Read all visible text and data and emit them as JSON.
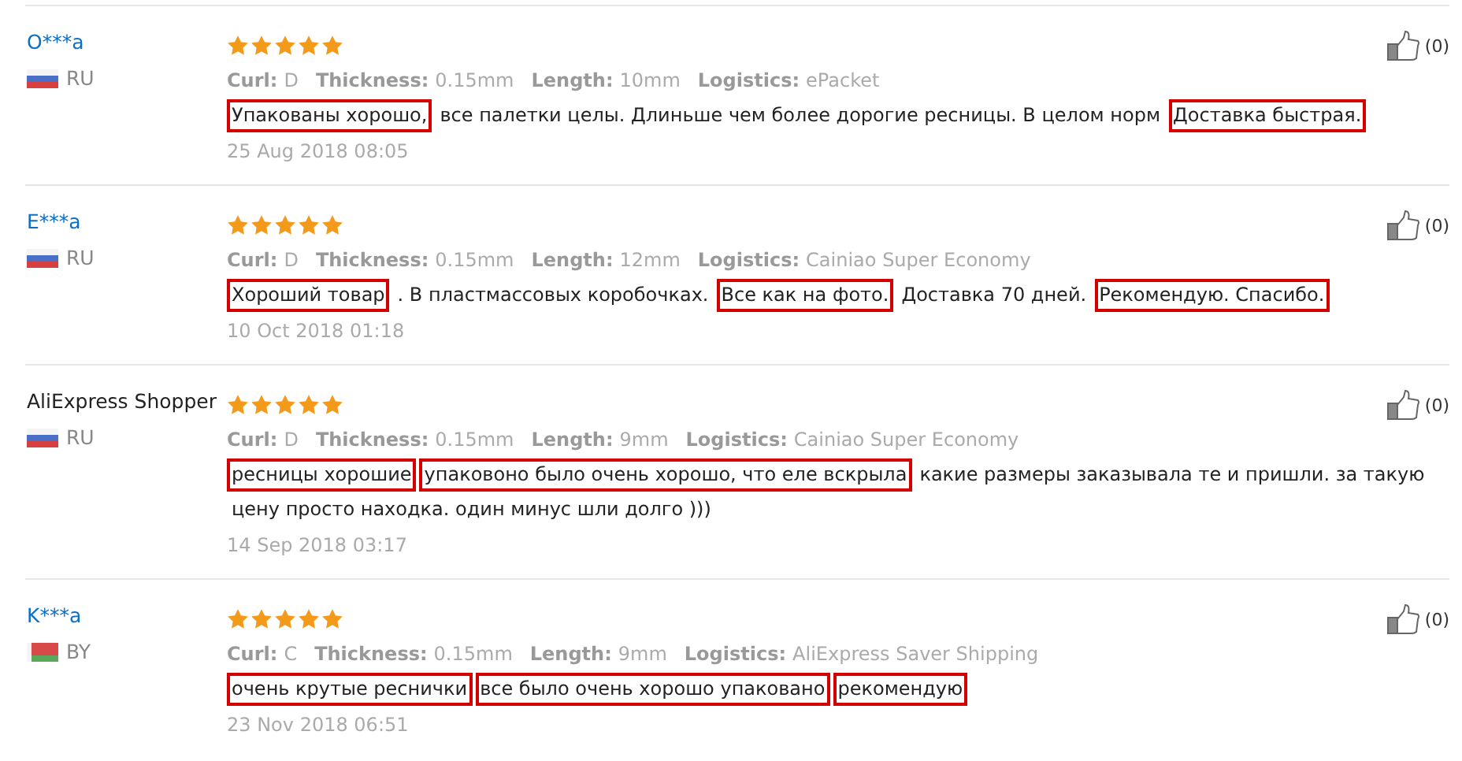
{
  "reviews": [
    {
      "name": "O***a",
      "linked": true,
      "flag": {
        "kind": "ru"
      },
      "country": "RU",
      "stars": 5,
      "likes": "(0)",
      "attributes": [
        {
          "label": "Curl:",
          "value": "D"
        },
        {
          "label": "Thickness:",
          "value": "0.15mm"
        },
        {
          "label": "Length:",
          "value": "10mm"
        },
        {
          "label": "Logistics:",
          "value": "ePacket"
        }
      ],
      "segments": [
        {
          "text": "Упакованы хорошо,",
          "highlighted": true
        },
        {
          "text": "все палетки целы. Длиньше чем более дорогие ресницы. В целом норм",
          "highlighted": false
        },
        {
          "text": "Доставка быстрая.",
          "highlighted": true
        }
      ],
      "date": "25 Aug 2018 08:05"
    },
    {
      "name": "E***a",
      "linked": true,
      "flag": {
        "kind": "ru"
      },
      "country": "RU",
      "stars": 5,
      "likes": "(0)",
      "attributes": [
        {
          "label": "Curl:",
          "value": "D"
        },
        {
          "label": "Thickness:",
          "value": "0.15mm"
        },
        {
          "label": "Length:",
          "value": "12mm"
        },
        {
          "label": "Logistics:",
          "value": "Cainiao Super Economy"
        }
      ],
      "segments": [
        {
          "text": "Хороший товар",
          "highlighted": true
        },
        {
          "text": ". В пластмассовых коробочках.",
          "highlighted": false
        },
        {
          "text": "Все как на фото.",
          "highlighted": true
        },
        {
          "text": "Доставка 70 дней.",
          "highlighted": false
        },
        {
          "text": "Рекомендую. Спасибо.",
          "highlighted": true
        }
      ],
      "date": "10 Oct 2018 01:18"
    },
    {
      "name": "AliExpress Shopper",
      "linked": false,
      "flag": {
        "kind": "ru"
      },
      "country": "RU",
      "stars": 5,
      "likes": "(0)",
      "attributes": [
        {
          "label": "Curl:",
          "value": "D"
        },
        {
          "label": "Thickness:",
          "value": "0.15mm"
        },
        {
          "label": "Length:",
          "value": "9mm"
        },
        {
          "label": "Logistics:",
          "value": "Cainiao Super Economy"
        }
      ],
      "segments": [
        {
          "text": "ресницы хорошие",
          "highlighted": true
        },
        {
          "text": "упаковоно было очень хорошо, что еле вскрыла",
          "highlighted": true
        },
        {
          "text": "какие размеры заказывала те и пришли. за такую",
          "highlighted": false
        },
        {
          "text": "цену просто находка. один минус шли долго )))",
          "highlighted": false
        }
      ],
      "date": "14 Sep 2018 03:17"
    },
    {
      "name": "K***a",
      "linked": true,
      "flag": {
        "kind": "by"
      },
      "country": "BY",
      "stars": 5,
      "likes": "(0)",
      "attributes": [
        {
          "label": "Curl:",
          "value": "C"
        },
        {
          "label": "Thickness:",
          "value": "0.15mm"
        },
        {
          "label": "Length:",
          "value": "9mm"
        },
        {
          "label": "Logistics:",
          "value": "AliExpress Saver Shipping"
        }
      ],
      "segments": [
        {
          "text": "очень крутые реснички",
          "highlighted": true
        },
        {
          "text": "все было очень хорошо упаковано",
          "highlighted": true
        },
        {
          "text": "рекомендую",
          "highlighted": true
        }
      ],
      "date": "23 Nov 2018 06:51"
    }
  ]
}
